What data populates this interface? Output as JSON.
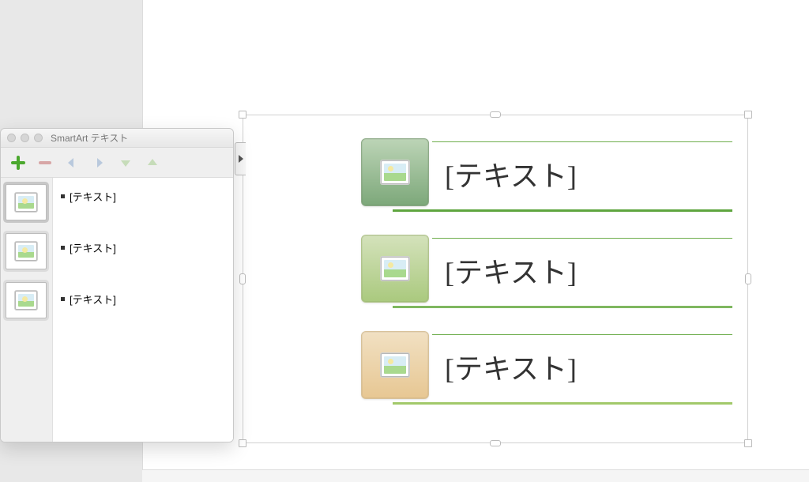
{
  "panel": {
    "title": "SmartArt テキスト",
    "toolbar": {
      "add": "add",
      "remove": "remove",
      "left": "left",
      "right": "right",
      "down": "down",
      "up": "up"
    },
    "items": [
      {
        "label": "[テキスト]"
      },
      {
        "label": "[テキスト]"
      },
      {
        "label": "[テキスト]"
      }
    ]
  },
  "smartart": {
    "rows": [
      {
        "text": "[テキスト]",
        "tone": "green1"
      },
      {
        "text": "[テキスト]",
        "tone": "green2"
      },
      {
        "text": "[テキスト]",
        "tone": "peach"
      }
    ]
  }
}
